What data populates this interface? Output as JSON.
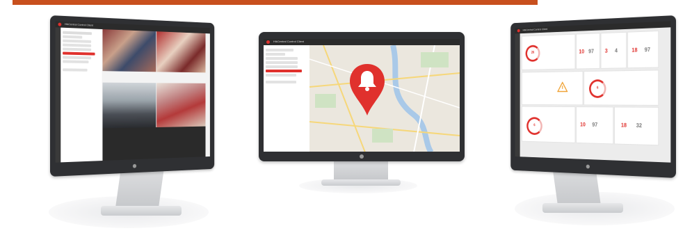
{
  "banner": {
    "color": "#c8501e"
  },
  "left_monitor": {
    "window_title": "HikCentral Control Client",
    "kind": "live-view",
    "tree_items": 8,
    "accent": "#e0312d"
  },
  "center_monitor": {
    "window_title": "HikCentral Control Client",
    "kind": "alarm-map",
    "alarm_icon": "bell-icon",
    "accent": "#e0312d"
  },
  "right_monitor": {
    "window_title": "HikCentral Control Client",
    "kind": "dashboard",
    "values": {
      "c1": "26",
      "c2a": "10",
      "c2b": "97",
      "c3a": "3",
      "c3b": "4",
      "c4a": "18",
      "c4b": "97",
      "c5": "6",
      "c6": "6",
      "c7a": "10",
      "c7b": "97",
      "c8a": "18",
      "c8b": "32"
    },
    "accent": "#e0312d"
  }
}
